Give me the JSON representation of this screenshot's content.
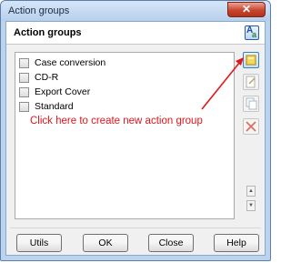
{
  "window": {
    "title": "Action groups",
    "close_glyph": "✕"
  },
  "header": {
    "title": "Action groups",
    "icon": "font-icon"
  },
  "list": {
    "items": [
      {
        "label": "Case conversion",
        "checked": false
      },
      {
        "label": "CD-R",
        "checked": false
      },
      {
        "label": "Export Cover",
        "checked": false
      },
      {
        "label": "Standard",
        "checked": false
      }
    ]
  },
  "annotation": {
    "text": "Click here to create new action group",
    "color": "#e0161c"
  },
  "side_buttons": {
    "new": "new-action-group-icon",
    "edit": "edit-icon",
    "duplicate": "duplicate-icon",
    "delete": "delete-icon",
    "up": "▲",
    "down": "▼"
  },
  "buttons": {
    "utils": "Utils",
    "ok": "OK",
    "close": "Close",
    "help": "Help"
  }
}
